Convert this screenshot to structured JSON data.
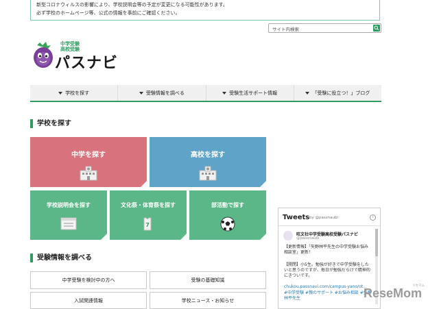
{
  "notice": {
    "line1": "新型コロナウィルスの影響により、学校説明会等の予定が変更になる可能性があります。",
    "line2": "必ず学校のホームページ等、公式の情報を事前にご確認ください。"
  },
  "search": {
    "placeholder": "サイト内検索",
    "icon": "search-icon"
  },
  "logo": {
    "sub1": "中学受験",
    "sub2": "高校受験",
    "main": "パスナビ"
  },
  "nav": [
    {
      "label": "学校を探す"
    },
    {
      "label": "受験情報を調べる"
    },
    {
      "label": "受験生活サポート情報"
    },
    {
      "label": "「受験に役立つ！」ブログ"
    }
  ],
  "section1": {
    "title": "学校を探す"
  },
  "tiles_big": [
    {
      "label": "中学を探す",
      "color": "#d8727c",
      "icon": "school-building-icon"
    },
    {
      "label": "高校を探す",
      "color": "#5fa3c9",
      "icon": "school-building-icon"
    }
  ],
  "tiles_small": [
    {
      "label": "学校説明会を探す",
      "color": "#5bb787",
      "icon": "calendar-icon"
    },
    {
      "label": "文化祭・体育祭を探す",
      "color": "#5bb787",
      "icon": "jersey-icon"
    },
    {
      "label": "部活動で探す",
      "color": "#5bb787",
      "icon": "soccer-ball-icon"
    }
  ],
  "section2": {
    "title": "受験情報を調べる"
  },
  "list_buttons": [
    {
      "label": "中学受験を検討中の方へ"
    },
    {
      "label": "受験の基礎知識"
    },
    {
      "label": "入試関連情報"
    },
    {
      "label": "学校ニュース・お知らせ"
    }
  ],
  "tweets": {
    "title": "Tweets",
    "by": "by @passnaubi",
    "account_name": "旺文社中学受験高校受験パスナビ",
    "account_handle": "@passnaubi",
    "tweet_line1": "【更新情報】「矢野林平先生の中学受験お悩み相談室」更新！",
    "tweet_line2": "【開閉】小5生。勉強が好きで中学受験をしたいと思うのですが、毎日が勉強だらけで精神的にきついです。",
    "tweet_link": "chukou.passnavi.com/campus-yano/ot...",
    "tweet_tags": "#中学受験 #親のサポート #お悩み相談 #矢野林平先生"
  },
  "watermark": {
    "main": "ReseMom",
    "sub": "リセマム"
  },
  "colors": {
    "brand_green": "#2e9b5f",
    "pink": "#d8727c",
    "blue": "#5fa3c9",
    "green": "#5bb787"
  }
}
